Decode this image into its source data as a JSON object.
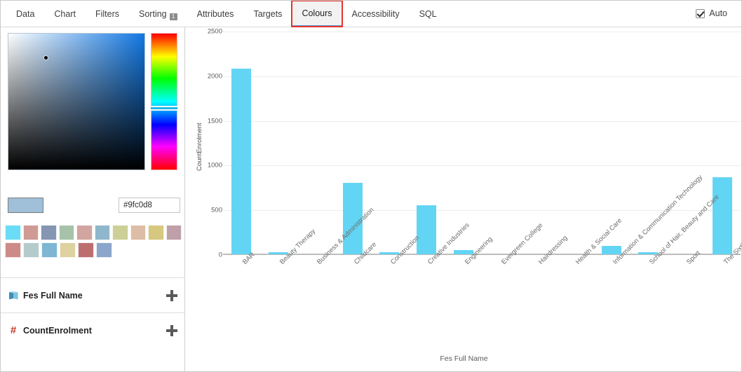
{
  "tabs": [
    {
      "label": "Data",
      "name": "tab-data",
      "active": false,
      "badge": null,
      "highlighted": false
    },
    {
      "label": "Chart",
      "name": "tab-chart",
      "active": false,
      "badge": null,
      "highlighted": false
    },
    {
      "label": "Filters",
      "name": "tab-filters",
      "active": false,
      "badge": null,
      "highlighted": false
    },
    {
      "label": "Sorting",
      "name": "tab-sorting",
      "active": false,
      "badge": "1",
      "highlighted": false
    },
    {
      "label": "Attributes",
      "name": "tab-attributes",
      "active": false,
      "badge": null,
      "highlighted": false
    },
    {
      "label": "Targets",
      "name": "tab-targets",
      "active": false,
      "badge": null,
      "highlighted": false
    },
    {
      "label": "Colours",
      "name": "tab-colours",
      "active": true,
      "badge": null,
      "highlighted": true
    },
    {
      "label": "Accessibility",
      "name": "tab-accessibility",
      "active": false,
      "badge": null,
      "highlighted": false
    },
    {
      "label": "SQL",
      "name": "tab-sql",
      "active": false,
      "badge": null,
      "highlighted": false
    }
  ],
  "toolbar": {
    "auto_label": "Auto",
    "auto_checked": true
  },
  "colour_picker": {
    "hex_value": "#9fc0d8",
    "hex_placeholder": "#rrggbb",
    "preview_colour": "#9fc0d8",
    "selected_hue_colour": "#1278e3",
    "palette_row_1": [
      "#6bdcf5",
      "#d09a95",
      "#8596b2",
      "#a6c3a9",
      "#d2a5a0",
      "#8fb7cb",
      "#cdd096",
      "#ddbda6",
      "#d7c87f",
      "#bfa0a8"
    ],
    "palette_row_2": [
      "#cc8b87",
      "#b4cbcb",
      "#7eb6d4",
      "#ded2a0",
      "#bd6f70",
      "#8ba6ca"
    ]
  },
  "fields": [
    {
      "label": "Fes Full Name",
      "icon": "dimension-icon",
      "add_label": "+"
    },
    {
      "label": "CountEnrolment",
      "icon": "measure-hash-icon",
      "add_label": "+"
    }
  ],
  "chart_data": {
    "type": "bar",
    "title": "",
    "xlabel": "Fes Full Name",
    "ylabel": "CountEnrolment",
    "ylim": [
      0,
      2500
    ],
    "yticks": [
      0,
      500,
      1000,
      1500,
      2000,
      2500
    ],
    "grid": true,
    "legend": false,
    "bar_colour": "#63d5f4",
    "categories": [
      "BAR",
      "Beauty Therapy",
      "Business & Administration",
      "Childcare",
      "Construction",
      "Creative Industries",
      "Engineering",
      "Evergreen College",
      "Hairdressing",
      "Health & Social Care",
      "Information & Communication Technology",
      "School of Hair, Beauty and Care",
      "Sport",
      "The Sixth Form Centre"
    ],
    "values": [
      2080,
      25,
      0,
      800,
      5,
      545,
      45,
      0,
      0,
      0,
      95,
      10,
      0,
      860
    ]
  }
}
